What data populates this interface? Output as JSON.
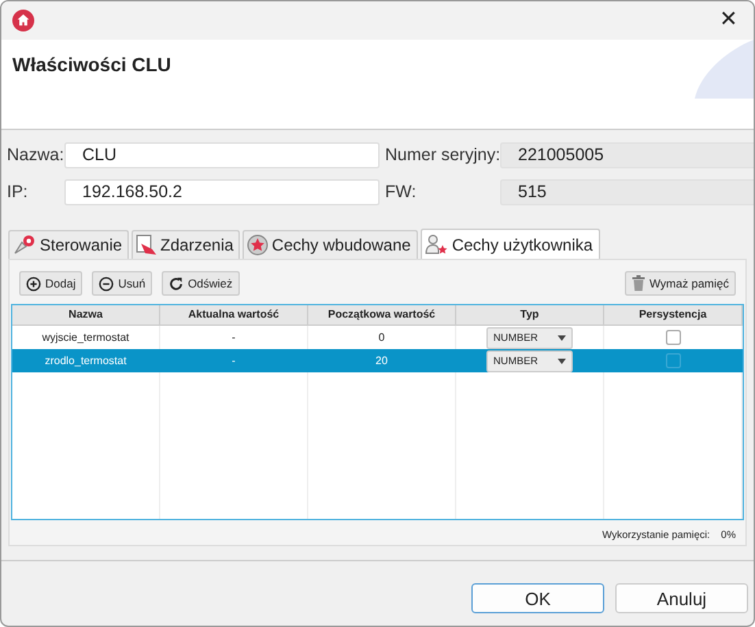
{
  "window": {
    "close": "✕"
  },
  "header": {
    "title": "Właściwości CLU"
  },
  "fields": [
    {
      "label": "Nazwa:",
      "value": "CLU",
      "readonly": false
    },
    {
      "label": "Numer seryjny:",
      "value": "221005005",
      "readonly": true
    },
    {
      "label": "IP:",
      "value": "192.168.50.2",
      "readonly": false
    },
    {
      "label": "FW:",
      "value": "515",
      "readonly": true
    }
  ],
  "tabs": [
    {
      "label": "Sterowanie",
      "selected": false
    },
    {
      "label": "Zdarzenia",
      "selected": false
    },
    {
      "label": "Cechy wbudowane",
      "selected": false
    },
    {
      "label": "Cechy użytkownika",
      "selected": true
    }
  ],
  "toolbar": {
    "buttons": [
      "Dodaj",
      "Usuń",
      "Odśwież"
    ],
    "clear_button": "Wymaż pamięć"
  },
  "table": {
    "columns": [
      "Nazwa",
      "Aktualna wartość",
      "Początkowa wartość",
      "Typ",
      "Persystencja"
    ],
    "rows": [
      {
        "name": "wyjscie_termostat",
        "current": "-",
        "initial": "0",
        "type": "NUMBER",
        "persistent": false,
        "selected": false
      },
      {
        "name": "zrodlo_termostat",
        "current": "-",
        "initial": "20",
        "type": "NUMBER",
        "persistent": false,
        "selected": true
      }
    ]
  },
  "memory": {
    "label": "Wykorzystanie pamięci:",
    "value": "0%"
  },
  "buttons": [
    {
      "label": "OK",
      "default": true
    },
    {
      "label": "Anuluj",
      "default": false
    }
  ]
}
